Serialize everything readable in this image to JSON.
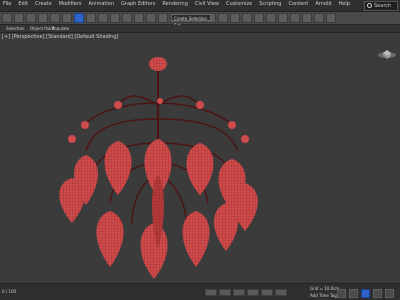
{
  "menu": {
    "items": [
      "File",
      "Edit",
      "Create",
      "Modifiers",
      "Animation",
      "Graph Editors",
      "Rendering",
      "Civil View",
      "Customize",
      "Scripting",
      "Content",
      "Arnold",
      "Help"
    ],
    "search": "Search"
  },
  "toolbar": {
    "selection_set": "Create Selection Set"
  },
  "ribbon": {
    "left": "Selection",
    "mid": "Object Paint",
    "right": "Populate"
  },
  "viewport": {
    "label": "[+] [Perspective] [Standard] [Default Shading]"
  },
  "status": {
    "left": "0 / 100",
    "readout1": "Grid = 10.0cm",
    "readout2": "Add Time Tag"
  },
  "colors": {
    "background": "#3b3b3b",
    "object": "#d04b4b",
    "wire": "#6a1a1a",
    "accent": "#2f63c7"
  }
}
